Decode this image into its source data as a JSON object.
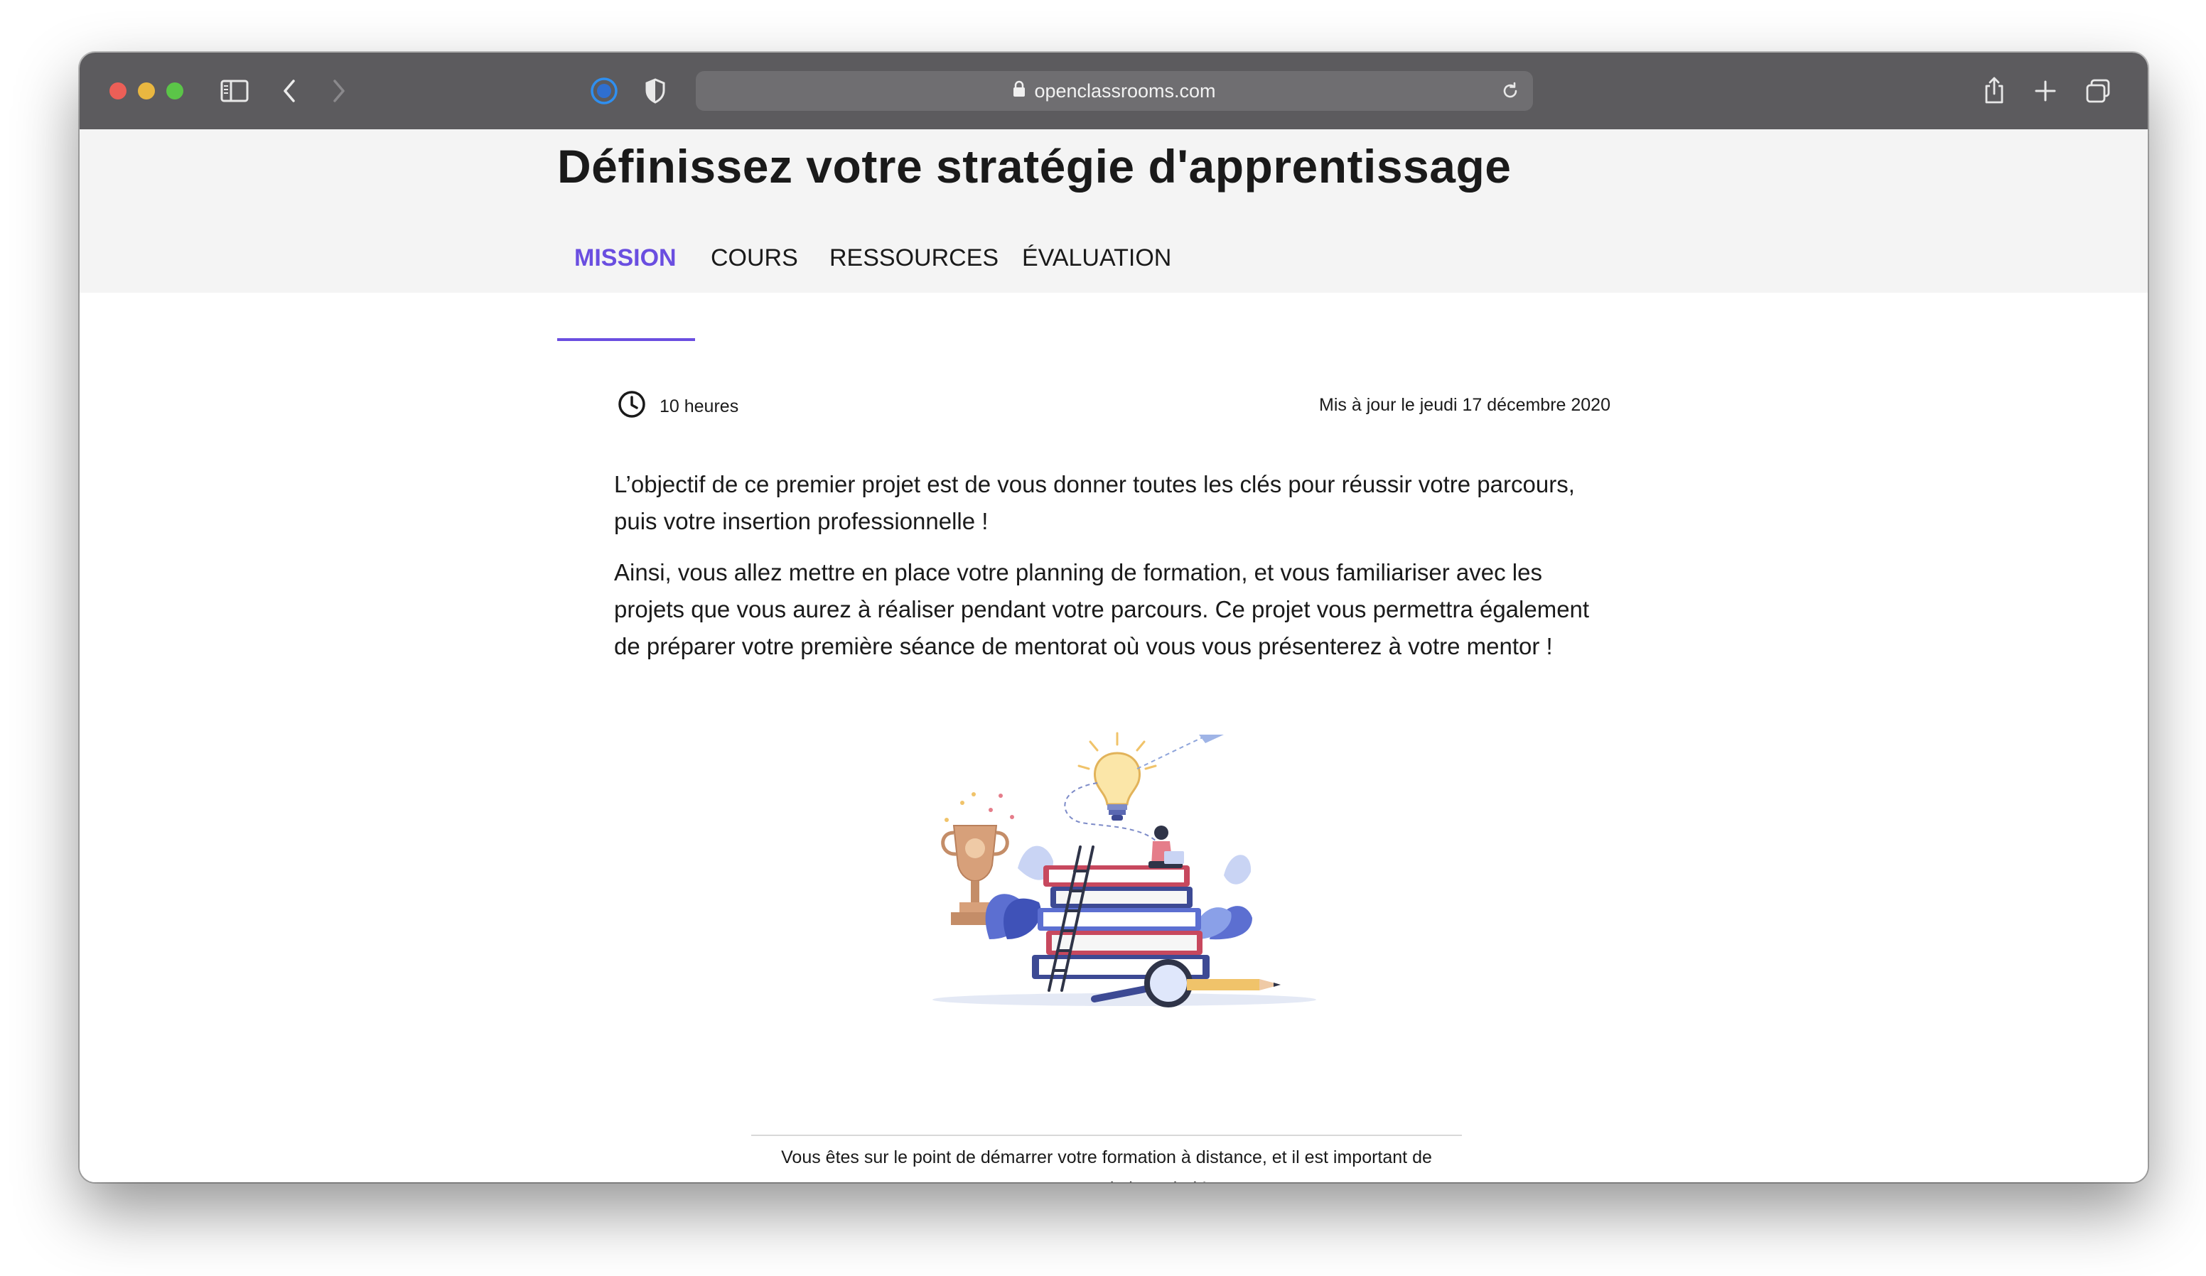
{
  "browser": {
    "url": "openclassrooms.com",
    "colors": {
      "close": "#ec5f57",
      "minimize": "#e9b740",
      "maximize": "#5bc548"
    }
  },
  "page": {
    "title": "Définissez votre stratégie d'apprentissage",
    "tabs": [
      {
        "label": "MISSION",
        "active": true
      },
      {
        "label": "COURS",
        "active": false
      },
      {
        "label": "RESSOURCES",
        "active": false
      },
      {
        "label": "ÉVALUATION",
        "active": false
      }
    ],
    "duration": "10 heures",
    "updated": "Mis à jour le jeudi 17 décembre 2020",
    "paragraphs": [
      "L’objectif de ce premier projet est de vous donner toutes les clés pour réussir votre parcours, puis votre insertion professionnelle !",
      "Ainsi, vous allez mettre en place votre planning de formation, et vous familiariser avec les projets que vous aurez à réaliser pendant votre parcours. Ce projet vous permettra également de préparer votre première séance de mentorat où vous vous présenterez à votre mentor !"
    ],
    "caption": "Vous êtes sur le point de démarrer votre formation à distance, et il est important de commencer du bon pied !",
    "accent_color": "#6a4ee0"
  }
}
